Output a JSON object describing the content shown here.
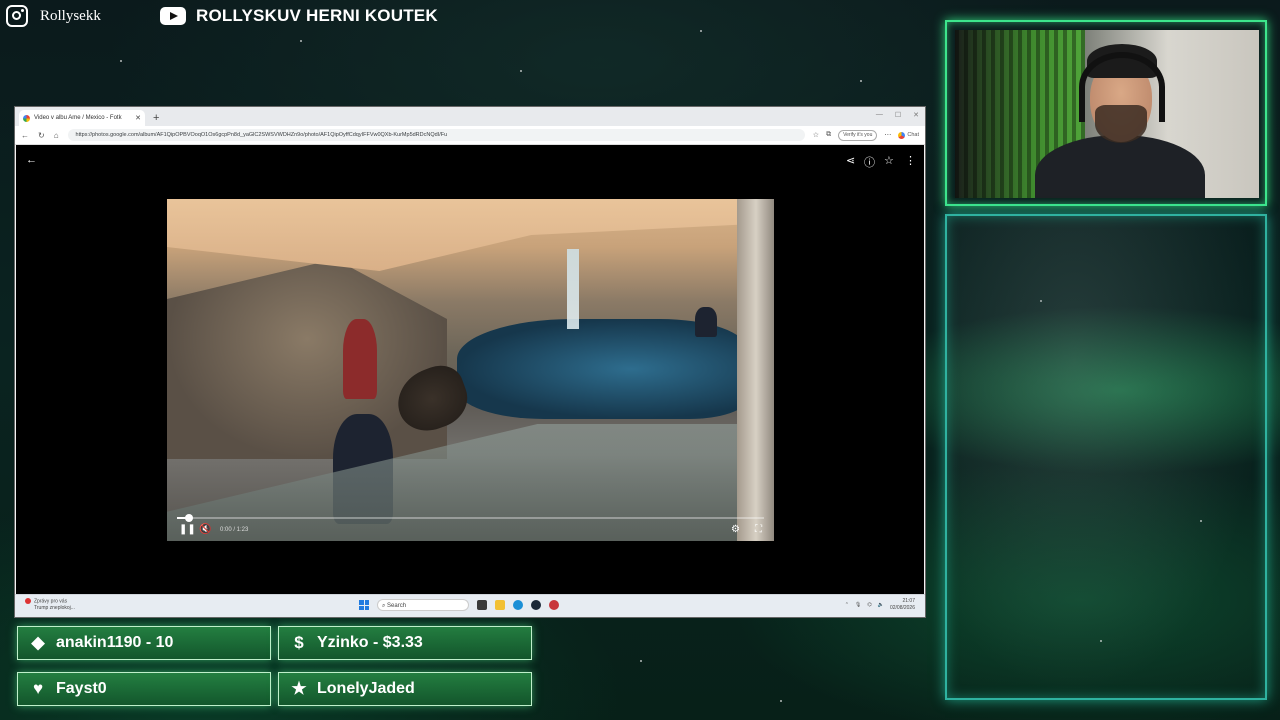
{
  "social": {
    "instagram_name": "Rollysekk",
    "youtube_name": "ROLLYSKUV HERNI KOUTEK"
  },
  "browser": {
    "tab_title": "Video v albu Ame / Mexico - Fotk",
    "url": "https://photos.google.com/album/AF1QipOPBVOoqO1Os6gcpPn8d_yaGlC2SWSVWDHZn9o/photo/AF1QipOyffCdqyIFFVw0QXb-KurMp5dRDcNQdI/Fu",
    "verify_label": "Verify it's you",
    "chat_label": "Chat"
  },
  "video": {
    "time": "0:00 / 1:23",
    "progress": 0.02
  },
  "taskbar": {
    "notification_title": "Zprávy pro vás",
    "notification_sub": "Trump zneplokoj...",
    "search_placeholder": "Search",
    "clock_time": "21:07",
    "clock_date": "02/08/2026"
  },
  "alerts": [
    {
      "icon": "diamond-icon",
      "text": "anakin1190 - 10"
    },
    {
      "icon": "dollar-icon",
      "text": "Yzinko - $3.33"
    },
    {
      "icon": "heart-icon",
      "text": "Fayst0"
    },
    {
      "icon": "star-icon",
      "text": "LonelyJaded"
    }
  ],
  "colors": {
    "accent_green": "#3de58c",
    "panel_teal": "#2fb2a0"
  }
}
